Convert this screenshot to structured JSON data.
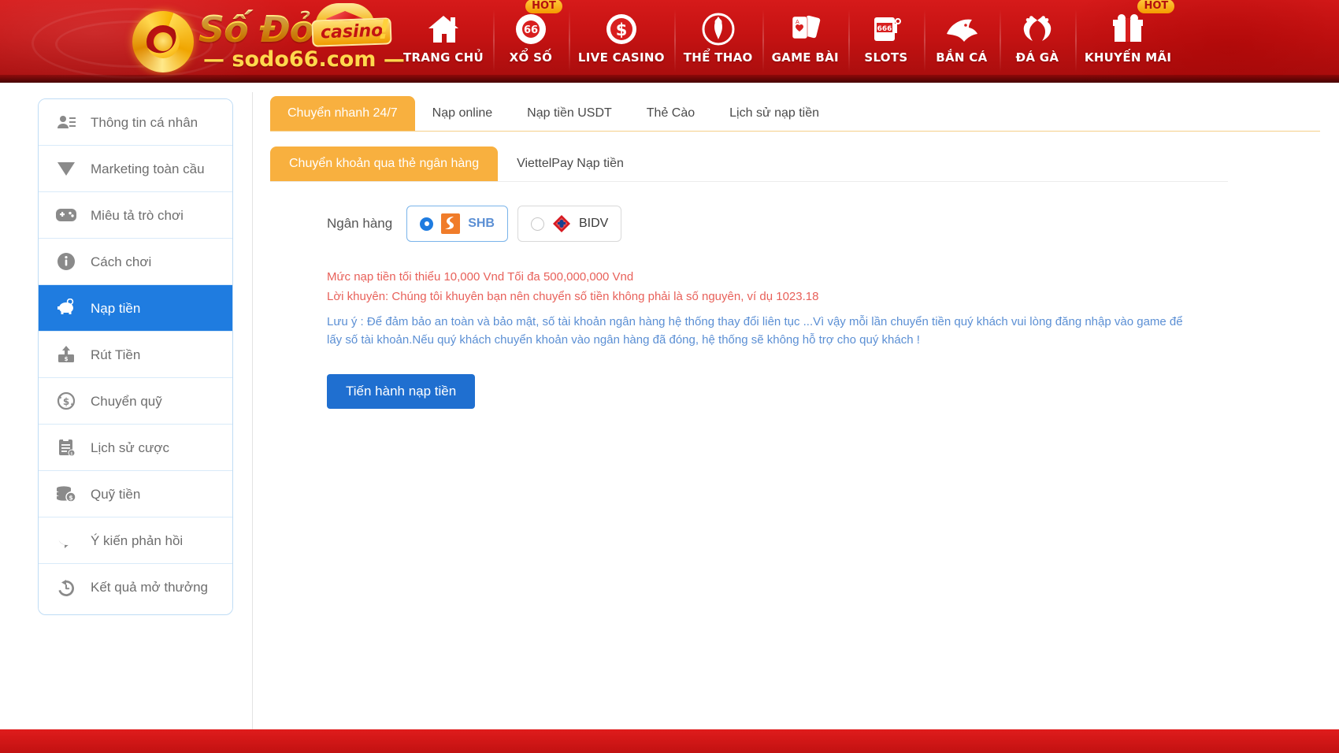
{
  "header": {
    "logo": {
      "main_text": "Số Đỏ",
      "badge_text": "casino",
      "sub_text": "— sodo66.com —",
      "exclaim": "!"
    },
    "nav": [
      {
        "label": "TRANG CHỦ",
        "icon": "home-icon",
        "badge": null
      },
      {
        "label": "XỔ SỐ",
        "icon": "lottery-ball-icon",
        "badge": "HOT"
      },
      {
        "label": "LIVE CASINO",
        "icon": "dollar-coin-icon",
        "badge": null
      },
      {
        "label": "THỂ THAO",
        "icon": "soccer-ball-icon",
        "badge": null
      },
      {
        "label": "GAME BÀI",
        "icon": "playing-cards-icon",
        "badge": null
      },
      {
        "label": "SLOTS",
        "icon": "slot-machine-icon",
        "badge": null
      },
      {
        "label": "BẮN CÁ",
        "icon": "fish-icon",
        "badge": null
      },
      {
        "label": "ĐÁ GÀ",
        "icon": "rooster-icon",
        "badge": null
      },
      {
        "label": "KHUYẾN MÃI",
        "icon": "gift-icon",
        "badge": "HOT"
      }
    ]
  },
  "sidebar": {
    "items": [
      {
        "label": "Thông tin cá nhân",
        "icon": "user-card-icon",
        "active": false
      },
      {
        "label": "Marketing toàn cầu",
        "icon": "diamond-icon",
        "active": false
      },
      {
        "label": "Miêu tả trò chơi",
        "icon": "gamepad-icon",
        "active": false
      },
      {
        "label": "Cách chơi",
        "icon": "info-icon",
        "active": false
      },
      {
        "label": "Nạp tiền",
        "icon": "piggy-bank-icon",
        "active": true
      },
      {
        "label": "Rút Tiền",
        "icon": "withdraw-icon",
        "active": false
      },
      {
        "label": "Chuyển quỹ",
        "icon": "transfer-dollar-icon",
        "active": false
      },
      {
        "label": "Lịch sử cược",
        "icon": "clipboard-icon",
        "active": false
      },
      {
        "label": "Quỹ tiền",
        "icon": "coins-stack-icon",
        "active": false
      },
      {
        "label": "Ý kiến phản hồi",
        "icon": "chat-bubble-icon",
        "active": false
      },
      {
        "label": "Kết quả mở thưởng",
        "icon": "history-clock-icon",
        "active": false
      }
    ]
  },
  "main": {
    "tabs": [
      {
        "label": "Chuyển nhanh 24/7",
        "active": true
      },
      {
        "label": "Nạp online",
        "active": false
      },
      {
        "label": "Nạp tiền USDT",
        "active": false
      },
      {
        "label": "Thẻ Cào",
        "active": false
      },
      {
        "label": "Lịch sử nạp tiền",
        "active": false
      }
    ],
    "subtabs": [
      {
        "label": "Chuyển khoản qua thẻ ngân hàng",
        "active": true
      },
      {
        "label": "ViettelPay Nạp tiền",
        "active": false
      }
    ],
    "bank": {
      "label": "Ngân hàng",
      "options": [
        {
          "name": "SHB",
          "selected": true,
          "logo": "shb-logo-icon"
        },
        {
          "name": "BIDV",
          "selected": false,
          "logo": "bidv-logo-icon"
        }
      ]
    },
    "notes": {
      "limit": "Mức nạp tiền tối thiểu 10,000 Vnd Tối đa 500,000,000 Vnd",
      "advice": "Lời khuyên: Chúng tôi khuyên bạn nên chuyển số tiền không phải là số nguyên, ví dụ 1023.18",
      "warning": "Lưu ý : Để đảm bảo an toàn và bảo mật, số tài khoản ngân hàng hệ thống thay đổi liên tục ...Vì vậy mỗi lần chuyển tiền quý khách vui lòng đăng nhập vào game để lấy số tài khoản.Nếu quý khách chuyển khoản vào ngân hàng đã đóng, hệ thống sẽ không hỗ trợ cho quý khách !"
    },
    "submit_label": "Tiến hành nạp tiền"
  },
  "colors": {
    "brand_red": "#c41212",
    "accent_orange": "#f8b03f",
    "primary_blue": "#1f7ce0",
    "note_red": "#e8615a",
    "note_blue": "#5b8fd4"
  }
}
